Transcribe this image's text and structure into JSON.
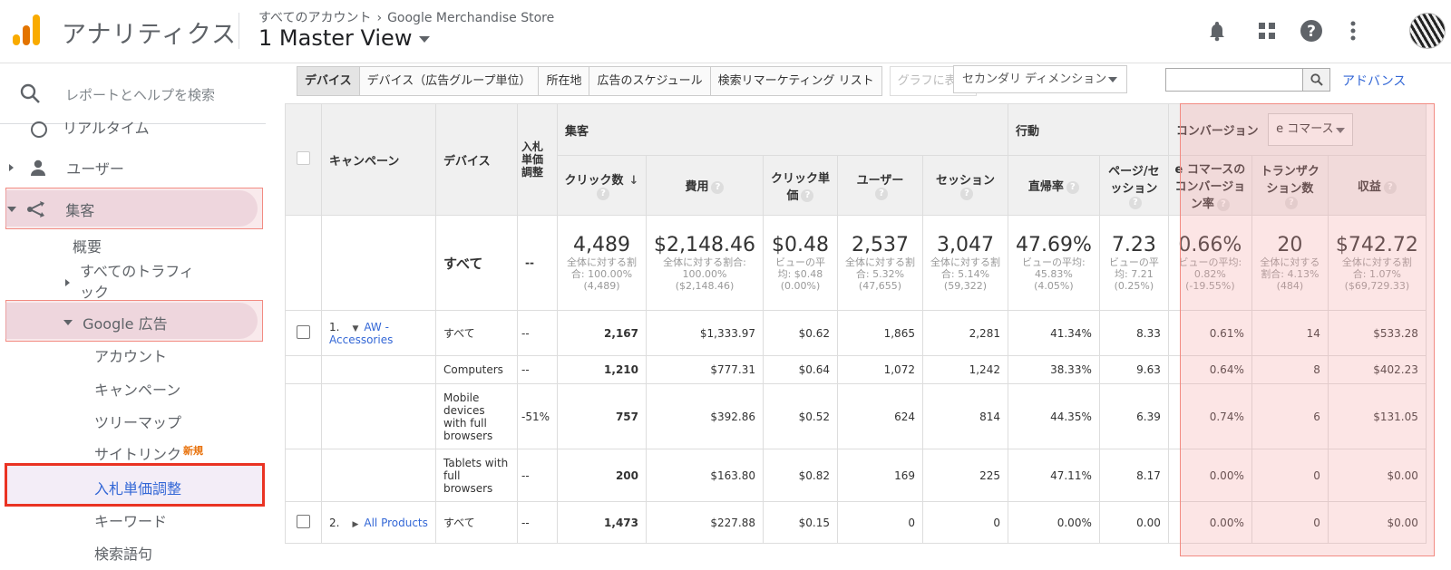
{
  "header": {
    "app_title": "アナリティクス",
    "breadcrumb_account": "すべてのアカウント",
    "breadcrumb_property": "Google Merchandise Store",
    "view_name": "1 Master View"
  },
  "sidebar": {
    "search_placeholder": "レポートとヘルプを検索",
    "clipped_item": "リアルタイム",
    "users": "ユーザー",
    "acquisition": "集客",
    "overview": "概要",
    "all_traffic_1": "すべてのトラフィ",
    "all_traffic_2": "ック",
    "google_ads": "Google 広告",
    "account": "アカウント",
    "campaign": "キャンペーン",
    "treemap": "ツリーマップ",
    "sitelinks": "サイトリンク",
    "sitelinks_badge": "新規",
    "bid_adjustments": "入札単価調整",
    "keywords": "キーワード",
    "search_queries": "検索語句"
  },
  "toolbar": {
    "tabs": [
      "デバイス",
      "デバイス（広告グループ単位）",
      "所在地",
      "広告のスケジュール",
      "検索リマーケティング リスト"
    ],
    "graph_btn": "グラフに表示",
    "secondary_dimension": "セカンダリ ディメンション",
    "advanced": "アドバンス"
  },
  "table": {
    "group_acq": "集客",
    "group_behavior": "行動",
    "group_conversion": "コンバージョン",
    "conversion_select": "e コマース",
    "col_campaign": "キャンペーン",
    "col_device": "デバイス",
    "col_bid": "入札単価調整",
    "col_clicks": "クリック数",
    "col_cost": "費用",
    "col_cpc": "クリック単価",
    "col_users": "ユーザー",
    "col_sessions": "セッション",
    "col_bounce": "直帰率",
    "col_pps": "ページ/セッション",
    "col_ecr": "e コマースのコンバージョン率",
    "col_tx": "トランザクション数",
    "col_rev": "収益",
    "summary": {
      "label": "すべて",
      "bid": "--",
      "clicks": "4,489",
      "clicks_sub": "全体に対する割合: 100.00% (4,489)",
      "cost": "$2,148.46",
      "cost_sub": "全体に対する割合: 100.00% ($2,148.46)",
      "cpc": "$0.48",
      "cpc_sub": "ビューの平均: $0.48 (0.00%)",
      "users": "2,537",
      "users_sub": "全体に対する割合: 5.32% (47,655)",
      "sessions": "3,047",
      "sessions_sub": "全体に対する割合: 5.14% (59,322)",
      "bounce": "47.69%",
      "bounce_sub": "ビューの平均: 45.83% (4.05%)",
      "pps": "7.23",
      "pps_sub": "ビューの平均: 7.21 (0.25%)",
      "ecr": "0.66%",
      "ecr_sub": "ビューの平均: 0.82% (-19.55%)",
      "tx": "20",
      "tx_sub": "全体に対する割合: 4.13% (484)",
      "rev": "$742.72",
      "rev_sub": "全体に対する割合: 1.07% ($69,729.33)"
    },
    "rows": [
      {
        "idx": "1.",
        "campaign": "AW - Accessories",
        "device": "すべて",
        "bid": "--",
        "clicks": "2,167",
        "cost": "$1,333.97",
        "cpc": "$0.62",
        "users": "1,865",
        "sessions": "2,281",
        "bounce": "41.34%",
        "pps": "8.33",
        "ecr": "0.61%",
        "tx": "14",
        "rev": "$533.28"
      },
      {
        "idx": "",
        "campaign": "",
        "device": "Computers",
        "bid": "--",
        "clicks": "1,210",
        "cost": "$777.31",
        "cpc": "$0.64",
        "users": "1,072",
        "sessions": "1,242",
        "bounce": "38.33%",
        "pps": "9.63",
        "ecr": "0.64%",
        "tx": "8",
        "rev": "$402.23"
      },
      {
        "idx": "",
        "campaign": "",
        "device": "Mobile devices with full browsers",
        "bid": "-51%",
        "clicks": "757",
        "cost": "$392.86",
        "cpc": "$0.52",
        "users": "624",
        "sessions": "814",
        "bounce": "44.35%",
        "pps": "6.39",
        "ecr": "0.74%",
        "tx": "6",
        "rev": "$131.05"
      },
      {
        "idx": "",
        "campaign": "",
        "device": "Tablets with full browsers",
        "bid": "--",
        "clicks": "200",
        "cost": "$163.80",
        "cpc": "$0.82",
        "users": "169",
        "sessions": "225",
        "bounce": "47.11%",
        "pps": "8.17",
        "ecr": "0.00%",
        "tx": "0",
        "rev": "$0.00"
      },
      {
        "idx": "2.",
        "campaign": "All Products",
        "device": "すべて",
        "bid": "--",
        "clicks": "1,473",
        "cost": "$227.88",
        "cpc": "$0.15",
        "users": "0",
        "sessions": "0",
        "bounce": "0.00%",
        "pps": "0.00",
        "ecr": "0.00%",
        "tx": "0",
        "rev": "$0.00"
      }
    ]
  }
}
